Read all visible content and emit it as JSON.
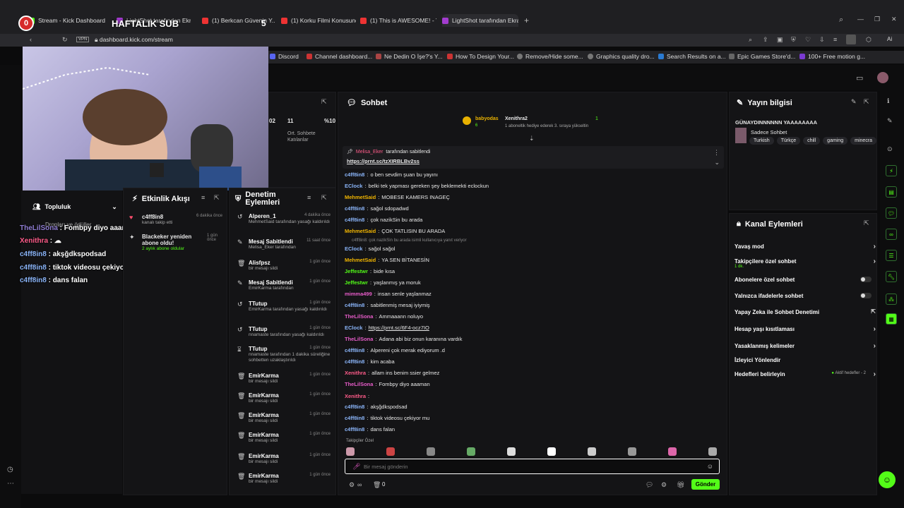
{
  "browser": {
    "tabs": [
      {
        "label": "Stream - Kick Dashboard"
      },
      {
        "label": "LightShot tarafından Ekra"
      },
      {
        "label": "(1) Berkcan Güvenin Y..."
      },
      {
        "label": "(1) Korku Filmi Konusunda"
      },
      {
        "label": "(1) This is AWESOME! - Yo"
      },
      {
        "label": "LightShot tarafından Ekran"
      }
    ],
    "address": "dashboard.kick.com/stream",
    "vpn_label": "VPN",
    "ai_label": "Ai",
    "bookmarks": [
      "Discord",
      "Channel dashboard...",
      "Ne Dedin O İşe?'s Y...",
      "How To Design Your...",
      "Remove/Hide some...",
      "Graphics quality dro...",
      "Search Results on a...",
      "Epic Games Store'd...",
      "100+ Free motion g..."
    ]
  },
  "overlay": {
    "counter_left": "0",
    "title": "HAFTALIK SUB",
    "counter_right": "5",
    "chat": [
      {
        "user": "TheLilSona",
        "text": "Fombpy diyo aaaman"
      },
      {
        "user": "Xenithra",
        "text": ""
      },
      {
        "user": "c4ff8in8",
        "text": "akşğdkspodsad"
      },
      {
        "user": "c4ff8in8",
        "text": "tiktok videosu çekiyor mu"
      },
      {
        "user": "c4ff8in8",
        "text": "dans falan"
      }
    ],
    "partial_label": "Dropları ve ödüller",
    "topluluk": "Topluluk",
    "bottom_num": "0"
  },
  "stats": {
    "values": [
      "02",
      "11",
      "%10"
    ],
    "labels": [
      "Ort. Sohbete Katılanlar"
    ]
  },
  "activity": {
    "title": "Etkinlik Akışı",
    "items": [
      {
        "user": "c4ff8in8",
        "desc": "kanalı takip etti",
        "time": "6 dakika önce"
      },
      {
        "user": "Blackeker yeniden abone oldu!",
        "desc": "2 aylık abone oldular",
        "time": "1 gün önce"
      }
    ]
  },
  "moderation": {
    "title": "Denetim Eylemleri",
    "items": [
      {
        "title": "Alperen_1",
        "desc": "MehmetSaid tarafından yasağı kaldırıldı",
        "time": "4 dakika önce"
      },
      {
        "title": "Mesaj Sabitlendi",
        "desc": "Melisa_Eker tarafından",
        "time": "11 saat önce"
      },
      {
        "title": "Alisfpsz",
        "desc": "bir mesajı sildi",
        "time": "1 gün önce"
      },
      {
        "title": "Mesaj Sabitlendi",
        "desc": "EmirKarma tarafından",
        "time": "1 gün önce"
      },
      {
        "title": "TTutup",
        "desc": "EmirKarma tarafından yasağı kaldırıldı",
        "time": "1 gün önce"
      },
      {
        "title": "TTutup",
        "desc": "nnamaste tarafından yasağı kaldırıldı",
        "time": "1 gün önce"
      },
      {
        "title": "TTutup",
        "desc": "nnamaste tarafından 1 dakika süreliğine sohbetten uzaklaştırıldı",
        "time": "1 gün önce"
      },
      {
        "title": "EmirKarma",
        "desc": "bir mesajı sildi",
        "time": "1 gün önce"
      },
      {
        "title": "EmirKarma",
        "desc": "bir mesajı sildi",
        "time": "1 gün önce"
      },
      {
        "title": "EmirKarma",
        "desc": "bir mesajı sildi",
        "time": "1 gün önce"
      },
      {
        "title": "EmirKarma",
        "desc": "bir mesajı sildi",
        "time": "1 gün önce"
      },
      {
        "title": "EmirKarma",
        "desc": "bir mesajı sildi",
        "time": "1 gün önce"
      },
      {
        "title": "EmirKarma",
        "desc": "bir mesajı sildi",
        "time": "1 gün önce"
      }
    ]
  },
  "chat": {
    "title": "Sohbet",
    "gift": {
      "user1": "babyodas",
      "count1": "6",
      "user2": "Xenithra2",
      "count2": "1",
      "note": "1 aboneltik hediye ederek 3. sıraya yükseltin"
    },
    "pinned": {
      "by": "Melisa_Eker",
      "label": "tarafından sabitlendi",
      "link": "https://prnt.sc/tzXIRBLBv2ss"
    },
    "messages": [
      {
        "user": "c4ff8in8",
        "color": "#8ab4f8",
        "text": "o ben sevdim şuan bu yayını"
      },
      {
        "user": "EClock",
        "color": "#8ab4f8",
        "text": "belki tek yapması gereken şey beklemekti eclockun"
      },
      {
        "user": "MehmetSaid",
        "color": "#f0b400",
        "text": "MOBESE KAMERS INAGEÇ"
      },
      {
        "user": "c4ff8in8",
        "color": "#8ab4f8",
        "text": "sağol sdopadwd"
      },
      {
        "user": "c4ff8in8",
        "color": "#8ab4f8",
        "text": "çok nazikSin bu arada"
      },
      {
        "user": "MehmetSaid",
        "color": "#f0b400",
        "text": "ÇOK TATLISIN BU ARADA"
      },
      {
        "user": "EClock",
        "color": "#8ab4f8",
        "text": "sağol sağol"
      },
      {
        "user": "MehmetSaid",
        "color": "#f0b400",
        "text": "YA SEN BİTANESİN"
      },
      {
        "user": "Jeffestwr",
        "color": "#53fc18",
        "text": "bide kısa"
      },
      {
        "user": "Jeffestwr",
        "color": "#53fc18",
        "text": "yaşlanmış ya moruk"
      },
      {
        "user": "mimma499",
        "color": "#e65cc8",
        "text": "insan senle yaşlanmaz"
      },
      {
        "user": "c4ff8in8",
        "color": "#8ab4f8",
        "text": "sabitlenmiş mesaj iyiymiş"
      },
      {
        "user": "TheLilSona",
        "color": "#e65cc8",
        "text": "Ammaaann noluyo"
      },
      {
        "user": "EClock",
        "color": "#8ab4f8",
        "text": "https://prnt.sc/6F4-ocz7IO"
      },
      {
        "user": "TheLilSona",
        "color": "#e65cc8",
        "text": "Adana abi biz onun karanına vardık"
      },
      {
        "user": "c4ff8in8",
        "color": "#8ab4f8",
        "text": "Alpereni çok merak ediyorum .d"
      },
      {
        "user": "c4ff8in8",
        "color": "#8ab4f8",
        "text": "kim acaba"
      },
      {
        "user": "Xenithra",
        "color": "#ff5c8a",
        "text": "allam ins benim ssier gelmez"
      },
      {
        "user": "TheLilSona",
        "color": "#e65cc8",
        "text": "Fombpy diyo aaaman"
      },
      {
        "user": "Xenithra",
        "color": "#ff5c8a",
        "text": ""
      },
      {
        "user": "c4ff8in8",
        "color": "#8ab4f8",
        "text": "akşğdkspodsad"
      },
      {
        "user": "c4ff8in8",
        "color": "#8ab4f8",
        "text": "tiktok videosu çekiyor mu"
      },
      {
        "user": "c4ff8in8",
        "color": "#8ab4f8",
        "text": "dans falan"
      }
    ],
    "reply_hint": "c4ff8in8: çok nazikSin bu arada isimli kullanıcıya yanıt veriyor",
    "followers_label": "Takipçiler Özel",
    "input_placeholder": "Bir mesaj gönderin",
    "send_label": "Gönder",
    "count": "0"
  },
  "stream_info": {
    "title": "Yayın bilgisi",
    "stream_title": "GÜNAYDINNNNNN YAAAAAAAA",
    "category": "Sadece Sohbet",
    "tags": [
      "Turkish",
      "Türkçe",
      "chill",
      "gaming",
      "minecra"
    ]
  },
  "channel_actions": {
    "title": "Kanal Eylemleri",
    "items": [
      {
        "label": "Yavaş mod",
        "kind": "chev"
      },
      {
        "label": "Takipçilere özel sohbet",
        "sub": "1 dk.",
        "kind": "chev"
      },
      {
        "label": "Abonelere özel sohbet",
        "kind": "toggle"
      },
      {
        "label": "Yalnızca ifadelerle sohbet",
        "kind": "toggle"
      },
      {
        "label": "Yapay Zeka ile Sohbet Denetimi",
        "kind": "ext"
      },
      {
        "label": "Hesap yaşı kısıtlaması",
        "kind": "chev"
      },
      {
        "label": "Yasaklanmış kelimeler",
        "kind": "chev"
      },
      {
        "label": "İzleyici Yönlendir",
        "kind": "none"
      },
      {
        "label": "Hedefleri belirleyin",
        "kind": "goal",
        "extra": "Aktif hedefler - 2"
      }
    ]
  },
  "colors": {
    "accent": "#53fc18",
    "panel": "#141416",
    "bg": "#0b0b0c"
  }
}
